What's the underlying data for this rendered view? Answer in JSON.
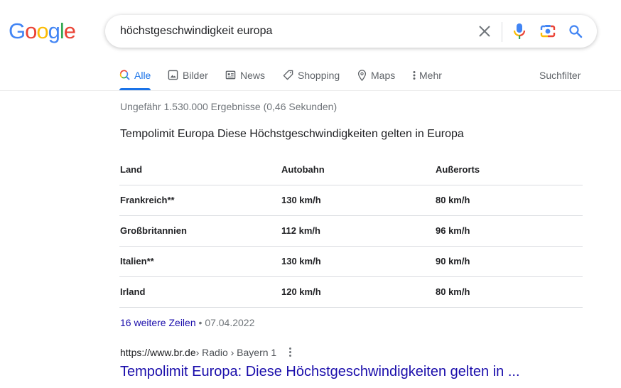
{
  "logo": {
    "letters": [
      "G",
      "o",
      "o",
      "g",
      "l",
      "e"
    ],
    "colors": [
      "#4285f4",
      "#ea4335",
      "#fbbc05",
      "#4285f4",
      "#34a853",
      "#ea4335"
    ]
  },
  "search": {
    "query": "höchstgeschwindigkeit europa",
    "clear_icon": "close-icon",
    "voice_icon": "microphone-icon",
    "lens_icon": "camera-lens-icon",
    "search_icon": "search-icon"
  },
  "nav": {
    "items": [
      {
        "label": "Alle",
        "icon": "search-icon",
        "active": true
      },
      {
        "label": "Bilder",
        "icon": "image-icon"
      },
      {
        "label": "News",
        "icon": "news-icon"
      },
      {
        "label": "Shopping",
        "icon": "tag-icon"
      },
      {
        "label": "Maps",
        "icon": "map-pin-icon"
      },
      {
        "label": "Mehr",
        "icon": "more-vertical-icon"
      }
    ],
    "suchfilter": "Suchfilter"
  },
  "stats": "Ungefähr 1.530.000 Ergebnisse (0,46 Sekunden)",
  "featured": {
    "title": "Tempolimit Europa Diese Höchstgeschwindigkeiten gelten in Europa",
    "table": {
      "headers": [
        "Land",
        "Autobahn",
        "Außerorts"
      ],
      "rows": [
        [
          "Frankreich**",
          "130 km/h",
          "80 km/h"
        ],
        [
          "Großbritannien",
          "112 km/h",
          "96 km/h"
        ],
        [
          "Italien**",
          "130 km/h",
          "90 km/h"
        ],
        [
          "Irland",
          "120 km/h",
          "80 km/h"
        ]
      ]
    },
    "more_rows_link": "16 weitere Zeilen",
    "separator": "•",
    "date": "07.04.2022"
  },
  "result": {
    "domain": "https://www.br.de",
    "path": " › Radio › Bayern 1",
    "title": "Tempolimit Europa: Diese Höchstgeschwindigkeiten gelten in ..."
  }
}
